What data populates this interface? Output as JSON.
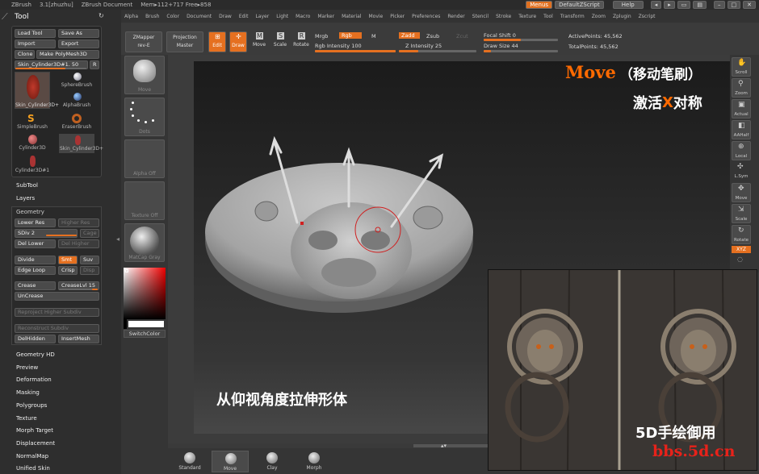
{
  "titlebar": {
    "app": "ZBrush",
    "version": "3.1[zhuzhu]",
    "doc": "ZBrush Document",
    "mem": "Mem▸112+717 Free▸858",
    "menus_btn": "Menus",
    "script_btn": "DefaultZScript",
    "help_btn": "Help"
  },
  "menubar": [
    "Alpha",
    "Brush",
    "Color",
    "Document",
    "Draw",
    "Edit",
    "Layer",
    "Light",
    "Macro",
    "Marker",
    "Material",
    "Movie",
    "Picker",
    "Preferences",
    "Render",
    "Stencil",
    "Stroke",
    "Texture",
    "Tool",
    "Transform",
    "Zoom",
    "Zplugin",
    "Zscript"
  ],
  "tool": {
    "title": "Tool",
    "load": "Load Tool",
    "save": "Save As",
    "import": "Import",
    "export": "Export",
    "clone": "Clone",
    "make_poly": "Make PolyMesh3D",
    "current": "Skin_Cylinder3D#1. 50",
    "r": "R",
    "thumbs": [
      "Skin_Cylinder3D+",
      "SphereBrush",
      "AlphaBrush",
      "SimpleBrush",
      "EraserBrush",
      "Cylinder3D",
      "Skin_Cylinder3D+",
      "Cylinder3D#1"
    ]
  },
  "sections": {
    "subtool": "SubTool",
    "layers": "Layers",
    "geometry": "Geometry",
    "geometry_hd": "Geometry HD",
    "preview": "Preview",
    "deformation": "Deformation",
    "masking": "Masking",
    "polygroups": "Polygroups",
    "texture": "Texture",
    "morph_target": "Morph Target",
    "displacement": "Displacement",
    "normalmap": "NormalMap",
    "unified_skin": "Unified Skin"
  },
  "geometry": {
    "lower_res": "Lower Res",
    "higher_res": "Higher Res",
    "sdiv": "SDiv 2",
    "cage": "Cage",
    "del_lower": "Del Lower",
    "del_higher": "Del Higher",
    "divide": "Divide",
    "smt": "Smt",
    "suv": "Suv",
    "edge_loop": "Edge Loop",
    "crisp": "Crisp",
    "disp": "Disp",
    "crease": "Crease",
    "creaselvl": "CreaseLvl 15",
    "uncrease": "UnCrease",
    "reproject": "Reproject Higher Subdiv",
    "reconstruct": "Reconstruct Subdiv",
    "delhidden": "DelHidden",
    "insertmesh": "InsertMesh"
  },
  "topshelf": {
    "zmapper": "ZMapper",
    "zmapper_rev": "rev-E",
    "projection": "Projection",
    "projection2": "Master",
    "edit": "Edit",
    "draw": "Draw",
    "move": "Move",
    "scale": "Scale",
    "rotate": "Rotate",
    "mrgb": "Mrgb",
    "rgb": "Rgb",
    "m": "M",
    "rgb_intensity": "Rgb Intensity 100",
    "zadd": "Zadd",
    "zsub": "Zsub",
    "zcut": "Zcut",
    "z_intensity": "Z Intensity 25",
    "focal_shift": "Focal Shift 0",
    "draw_size": "Draw Size 44",
    "active_points": "ActivePoints: 45,562",
    "total_points": "TotalPoints: 45,562"
  },
  "leftshelf": [
    "Move",
    "Dots",
    "Alpha Off",
    "Texture Off",
    "MatCap Gray"
  ],
  "switchcolor": "SwitchColor",
  "rightshelf": [
    "Scroll",
    "Zoom",
    "Actual",
    "AAHalf",
    "Local",
    "L.Sym",
    "Move",
    "Scale",
    "Rotate"
  ],
  "xyz": "XYZ",
  "bottomshelf": [
    "Standard",
    "Move",
    "Clay",
    "Morph"
  ],
  "overlay": {
    "move_title": "Move",
    "move_note": "（移动笔刷）",
    "activate_sym": "激活",
    "x_letter": "X",
    "sym_word": "对称",
    "stretch": "从仰视角度拉伸形体",
    "site_label": "5D手绘御用",
    "site_url": "bbs.5d.cn"
  },
  "colors": {
    "accent": "#e57020",
    "overlay_orange": "#ff6a00",
    "site_red": "#e8221a"
  }
}
